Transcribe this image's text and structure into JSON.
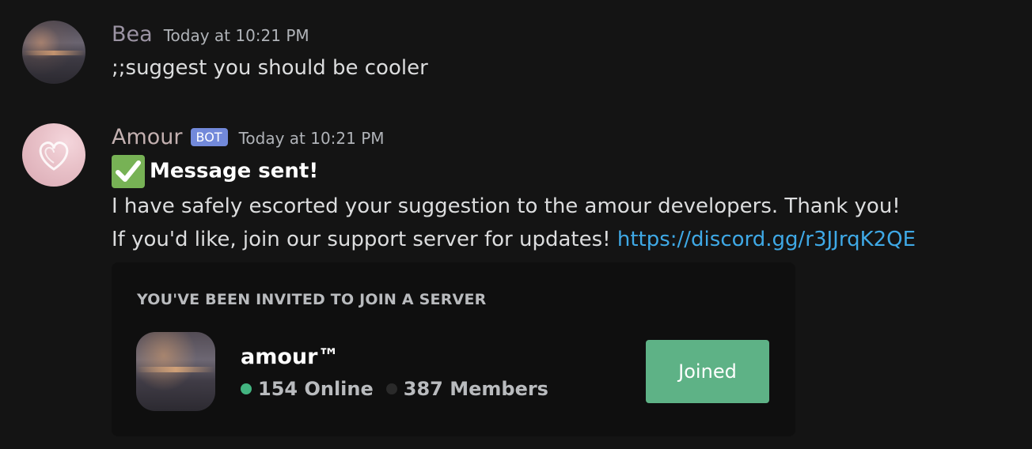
{
  "messages": [
    {
      "username": "Bea",
      "username_color": "#9b93a3",
      "timestamp": "Today at 10:21 PM",
      "text": ";;suggest you should be cooler"
    },
    {
      "username": "Amour",
      "username_color": "#c4b1b1",
      "bot_tag": "BOT",
      "timestamp": "Today at 10:21 PM",
      "emoji": "check-mark-button-icon",
      "heading": "Message sent!",
      "line1": "I have safely escorted your suggestion to the amour developers. Thank you!",
      "line2": "If you'd like, join our support server for updates!",
      "link": "https://discord.gg/r3JJrqK2QE",
      "invite": {
        "title": "YOU'VE BEEN INVITED TO JOIN A SERVER",
        "server_name": "amour™",
        "online": "154 Online",
        "members": "387 Members",
        "button_label": "Joined"
      }
    }
  ],
  "colors": {
    "background": "#141414",
    "link": "#3fa9e6",
    "bot_tag": "#7289da",
    "online": "#43b581",
    "joined_button": "#5eb286"
  }
}
